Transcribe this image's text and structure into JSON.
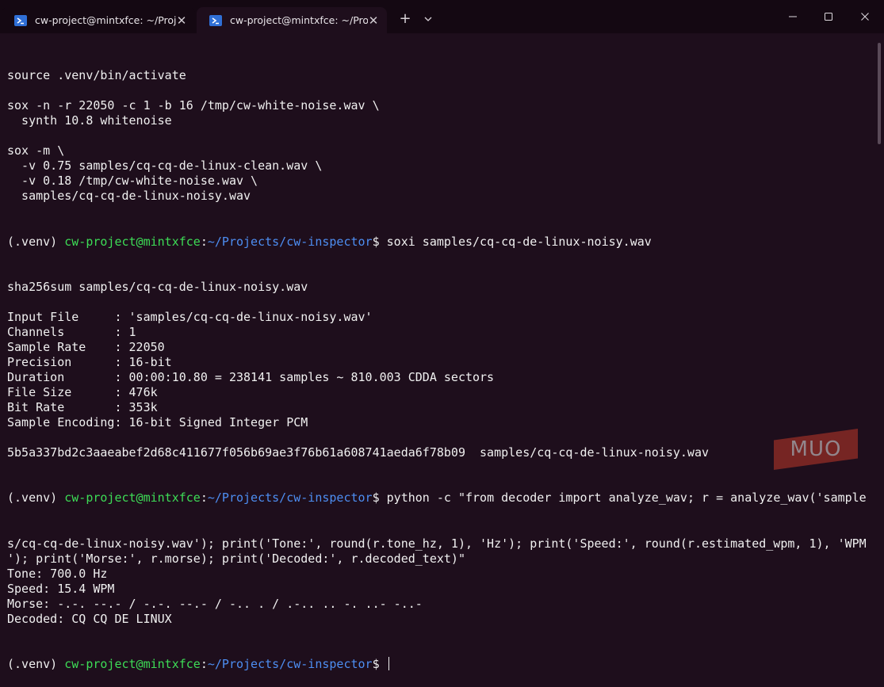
{
  "tabs": [
    {
      "title": "cw-project@mintxfce: ~/Proje",
      "icon": "terminal-icon"
    },
    {
      "title": "cw-project@mintxfce: ~/Proje",
      "icon": "terminal-icon"
    }
  ],
  "titlebar": {
    "new_tab": "+",
    "dropdown_icon": "chevron-down-icon"
  },
  "window_controls": [
    "minimize-icon",
    "maximize-icon",
    "close-icon"
  ],
  "prompt": {
    "venv": "(.venv) ",
    "user": "cw-project@mintxfce",
    "sep": ":",
    "path": "~/Projects/cw-inspector",
    "symbol": "$ "
  },
  "terminal": {
    "block1": [
      "source .venv/bin/activate",
      "",
      "sox -n -r 22050 -c 1 -b 16 /tmp/cw-white-noise.wav \\",
      "  synth 10.8 whitenoise",
      "",
      "sox -m \\",
      "  -v 0.75 samples/cq-cq-de-linux-clean.wav \\",
      "  -v 0.18 /tmp/cw-white-noise.wav \\",
      "  samples/cq-cq-de-linux-noisy.wav"
    ],
    "cmd1": "soxi samples/cq-cq-de-linux-noisy.wav",
    "block2": [
      "sha256sum samples/cq-cq-de-linux-noisy.wav",
      "",
      "Input File     : 'samples/cq-cq-de-linux-noisy.wav'",
      "Channels       : 1",
      "Sample Rate    : 22050",
      "Precision      : 16-bit",
      "Duration       : 00:00:10.80 = 238141 samples ~ 810.003 CDDA sectors",
      "File Size      : 476k",
      "Bit Rate       : 353k",
      "Sample Encoding: 16-bit Signed Integer PCM",
      "",
      "5b5a337bd2c3aaeabef2d68c411677f056b69ae3f76b61a608741aeda6f78b09  samples/cq-cq-de-linux-noisy.wav"
    ],
    "cmd2": "python -c \"from decoder import analyze_wav; r = analyze_wav('sample",
    "block3": [
      "s/cq-cq-de-linux-noisy.wav'); print('Tone:', round(r.tone_hz, 1), 'Hz'); print('Speed:', round(r.estimated_wpm, 1), 'WPM",
      "'); print('Morse:', r.morse); print('Decoded:', r.decoded_text)\"",
      "Tone: 700.0 Hz",
      "Speed: 15.4 WPM",
      "Morse: -.-. --.- / -.-. --.- / -.. . / .-.. .. -. ..- -..-",
      "Decoded: CQ CQ DE LINUX"
    ]
  },
  "watermark": {
    "text": "MUO",
    "color": "#c0392b"
  },
  "colors": {
    "background": "#1e0e1c",
    "user": "#3ddc56",
    "path": "#4d8ef2",
    "text": "#f0f0f0"
  }
}
